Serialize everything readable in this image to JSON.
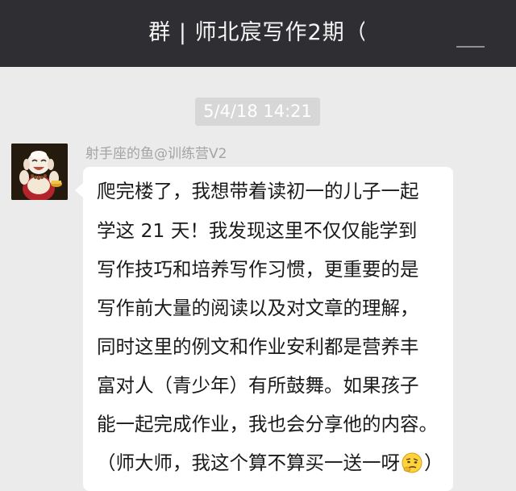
{
  "header": {
    "title": "群 | 师北宸写作2期（"
  },
  "chat": {
    "timestamp": "5/4/18 14:21",
    "message": {
      "sender": "射手座的鱼@训练营V2",
      "lines": [
        "爬完楼了，我想带着读初一的儿子一起",
        "学这 21 天！我发现这里不仅仅能学到",
        "写作技巧和培养写作习惯，更重要的是",
        "写作前大量的阅读以及对文章的理解，",
        "同时这里的例文和作业安利都是营养丰",
        "富对人（青少年）有所鼓舞。如果孩子",
        "能一起完成作业，我也会分享他的内容。",
        "（师大师，我这个算不算买一送一呀"
      ],
      "closing": "）",
      "emoji_icon": "thinking-smirk-emoji"
    }
  },
  "colors": {
    "header_bg": "#2f2f33",
    "chat_bg": "#ebebeb",
    "bubble_bg": "#ffffff",
    "timestamp_bg": "#d7d7d7"
  }
}
